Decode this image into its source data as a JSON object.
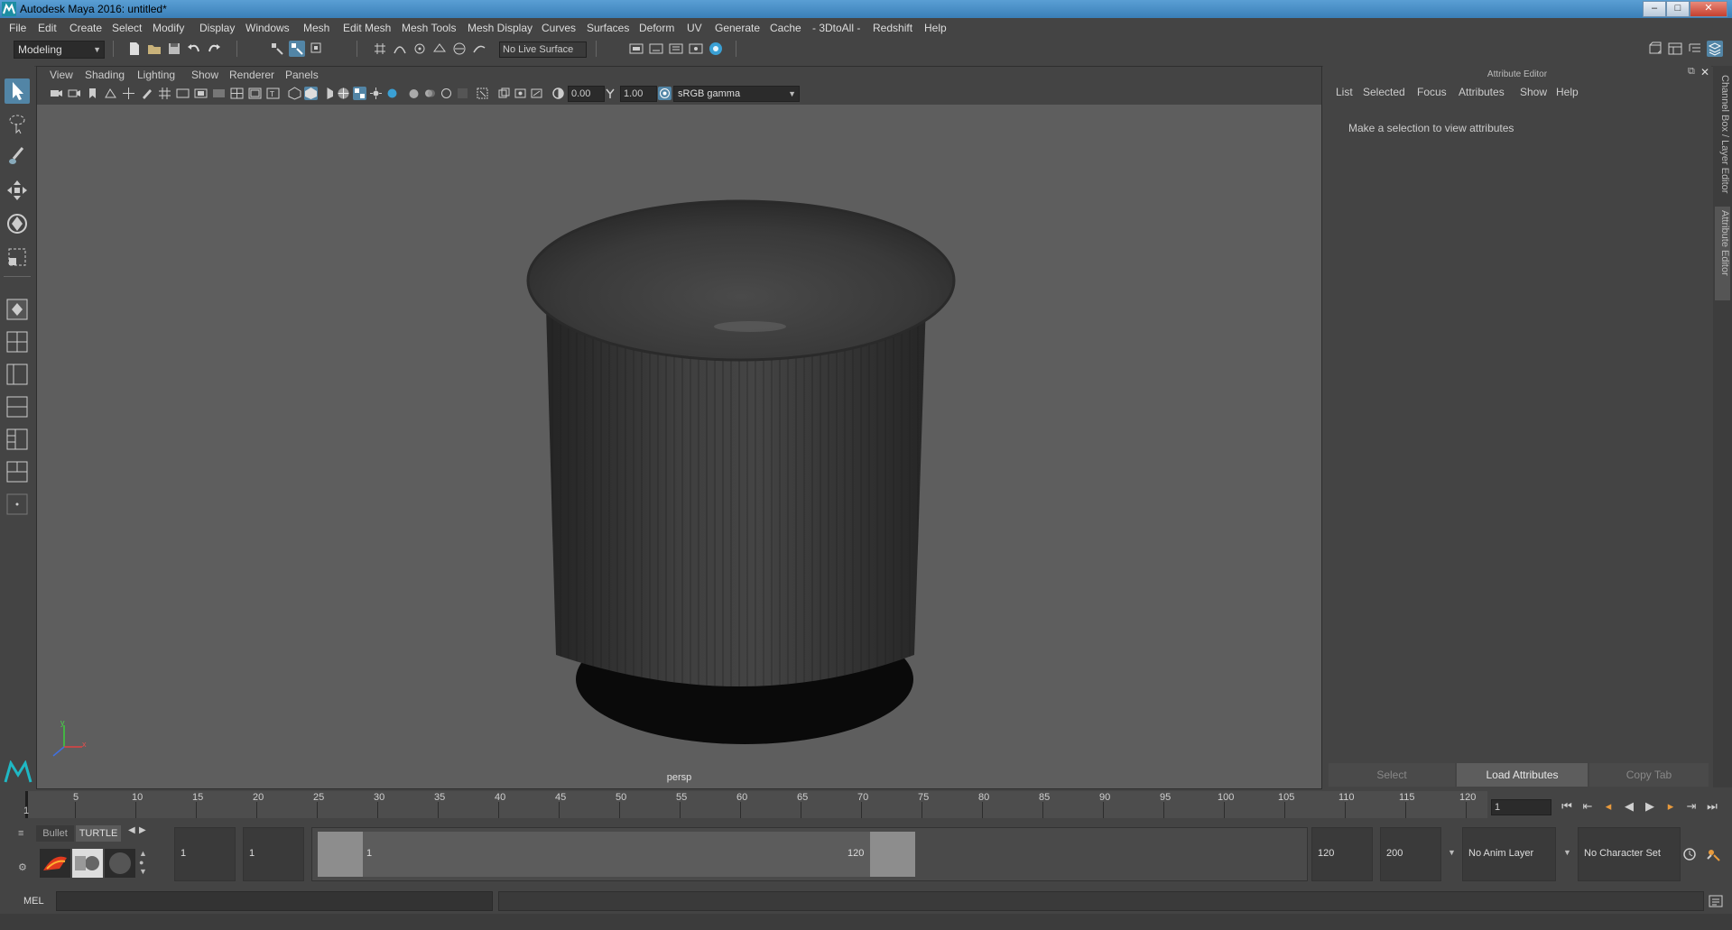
{
  "window": {
    "title": "Autodesk Maya 2016: untitled*",
    "min": "–",
    "max": "□",
    "close": "✕"
  },
  "menubar": [
    "File",
    "Edit",
    "Create",
    "Select",
    "Modify",
    "Display",
    "Windows",
    "Mesh",
    "Edit Mesh",
    "Mesh Tools",
    "Mesh Display",
    "Curves",
    "Surfaces",
    "Deform",
    "UV",
    "Generate",
    "Cache",
    "- 3DtoAll -",
    "Redshift",
    "Help"
  ],
  "statusline": {
    "menuset": "Modeling",
    "live_surface": "No Live Surface"
  },
  "viewport": {
    "menus": [
      "View",
      "Shading",
      "Lighting",
      "Show",
      "Renderer",
      "Panels"
    ],
    "exposure": "0.00",
    "gamma": "1.00",
    "color_space": "sRGB gamma",
    "camera_label": "persp",
    "axis_x": "x",
    "axis_y": "y"
  },
  "attribute_editor": {
    "header": "Attribute Editor",
    "menus": [
      "List",
      "Selected",
      "Focus",
      "Attributes",
      "Show",
      "Help"
    ],
    "message": "Make a selection to view attributes",
    "buttons": {
      "select": "Select",
      "load": "Load Attributes",
      "copy": "Copy Tab"
    }
  },
  "side_tabs": {
    "channel_box": "Channel Box / Layer Editor",
    "attribute_editor": "Attribute Editor"
  },
  "timeslider": {
    "ticks": [
      "5",
      "10",
      "15",
      "20",
      "25",
      "30",
      "35",
      "40",
      "45",
      "50",
      "55",
      "60",
      "65",
      "70",
      "75",
      "80",
      "85",
      "90",
      "95",
      "100",
      "105",
      "110",
      "115",
      "120"
    ],
    "start_label": "1",
    "current_frame": "1"
  },
  "shelf": {
    "tab_bullet": "Bullet",
    "tab_turtle": "TURTLE"
  },
  "range": {
    "start": "1",
    "playback_start": "1",
    "slider_start": "1",
    "slider_end": "120",
    "playback_end": "120",
    "end": "200",
    "anim_layer": "No Anim Layer",
    "character_set": "No Character Set"
  },
  "command": {
    "lang": "MEL"
  },
  "colors": {
    "accent": "#5285a6",
    "viewport": "#5e5e5e",
    "ui_bg": "#444444"
  }
}
